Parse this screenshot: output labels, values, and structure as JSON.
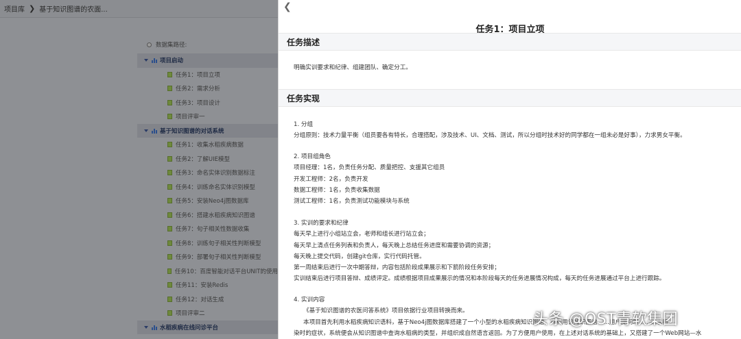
{
  "breadcrumb": {
    "root": "项目库",
    "separator": "❯",
    "current": "基于知识图谱的农面..."
  },
  "tree": {
    "root_label": "数据集路径:",
    "groups": [
      {
        "label": "项目启动",
        "items": [
          "任务1：项目立项",
          "任务2：需求分析",
          "任务3：项目设计",
          "项目评审一"
        ]
      },
      {
        "label": "基于知识图谱的对话系统",
        "items": [
          "任务1：收集水稻疾病数据",
          "任务2：了解UIE模型",
          "任务3：命名实体识别数据标注",
          "任务4：训练命名实体识别模型",
          "任务5：安装Neo4j图数据库",
          "任务6：搭建水稻疾病知识图谱",
          "任务7：句子相关性数据收集",
          "任务8：训练句子相关性判断模型",
          "任务9：部署句子相关性判断模型",
          "任务10：百度智能对话平台UNIT的使用",
          "任务11：安装Redis",
          "任务12：对话生成",
          "项目评审二"
        ]
      },
      {
        "label": "水稻疾病在线问诊平台",
        "items": []
      }
    ]
  },
  "drawer": {
    "back_glyph": "❮",
    "title": "任务1：项目立项",
    "section_desc": {
      "heading": "任务描述",
      "text": "明确实训要求和纪律、组建团队、确定分工。"
    },
    "section_impl": {
      "heading": "任务实现",
      "block1": [
        "1. 分组",
        "分组原则：技术力量平衡（组员要各有特长，合理搭配，涉及技术、UI、文档、测试，所以分组时技术好的同学都在一组未必是好事），力求男女平衡。"
      ],
      "block2": [
        "2. 项目组角色",
        "项目经理：1名，负责任务分配、质量把控、支援其它组员",
        "开发工程师：2名，负责开发",
        "数据工程师：1名，负责收集数据",
        "测试工程师：1名，负责测试功能模块与系统"
      ],
      "block3": [
        "3. 实训的要求和纪律",
        "每天早上进行小组站立会，老师和组长进行站立会；",
        "每天早上清点任务列表和负责人，每天晚上总结任务进度和需要协调的资源；",
        "每天晚上提交代码，创建git仓库，实行代码托管。",
        "第一周结束后进行一次中期答辩，内容包括阶段成果展示和下箭阶段任务安排；",
        "实训结束后进行项目答辩、成绩评定。成绩根据项目成果展示的情况和本阶段每天的任务进展情况构成，每天的任务进展通过平台上进行跟踪。"
      ],
      "block4": [
        "4. 实训内容",
        "《基于知识图谱的农医问答系统》项目依据行业项目转换而来。",
        "本项目首先利用水稻疾病知识语料，基于Neo4j图数据库搭建了一个小型的水稻疾病知识图谱，并利用该知识图谱……用户提问时……的水稻",
        "染时的症状，系统便会从知识图谱中查询水稻病的类型，并组织成自然语言返回。为了方便用户使用，在上述对话系统的基础上，又搭建了一个Web网站—水"
      ]
    }
  },
  "watermark": "头条 @OST青软集团"
}
